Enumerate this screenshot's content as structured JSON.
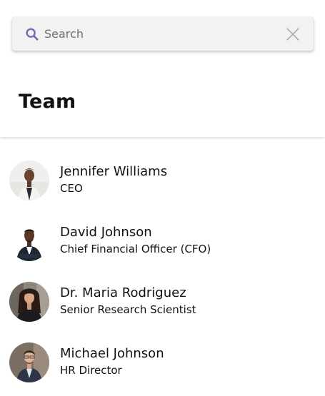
{
  "search": {
    "placeholder": "Search",
    "value": "",
    "icon": "search-icon",
    "clear_icon": "close-icon"
  },
  "header": {
    "title": "Team"
  },
  "team": {
    "members": [
      {
        "name": "Jennifer Williams",
        "title": "CEO"
      },
      {
        "name": "David Johnson",
        "title": "Chief Financial Officer (CFO)"
      },
      {
        "name": "Dr. Maria Rodriguez",
        "title": "Senior Research Scientist"
      },
      {
        "name": "Michael Johnson",
        "title": "HR Director"
      }
    ]
  },
  "colors": {
    "accent": "#6b6fb0",
    "search_bg": "#f2f2f2",
    "clear_icon": "#9a9ab0"
  }
}
